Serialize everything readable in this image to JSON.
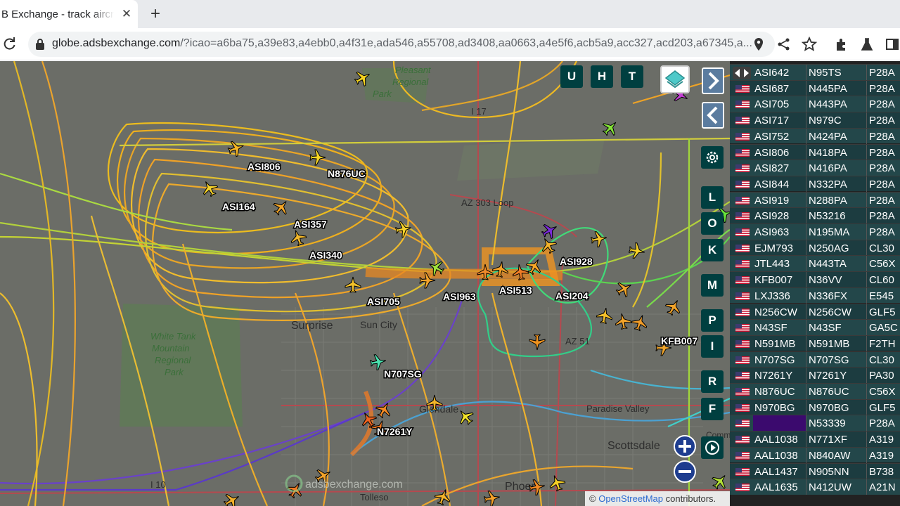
{
  "browser": {
    "tab_title": "B Exchange - track aircraft",
    "url_host": "globe.adsbexchange.com",
    "url_path": "/?icao=a6ba75,a39e83,a4ebb0,a4f31e,ada546,a55708,ad3408,aa0663,a4e5f6,acb5a9,acc327,acd203,a67345,a..."
  },
  "map_controls": {
    "u_label": "U",
    "h_label": "H",
    "t_label": "T",
    "side_buttons": [
      "L",
      "O",
      "K",
      "M",
      "P",
      "I",
      "R",
      "F"
    ]
  },
  "map": {
    "places": [
      {
        "text": "Surprise"
      },
      {
        "text": "Sun City"
      },
      {
        "text": "Scottsdale"
      },
      {
        "text": "Paradise Valley"
      },
      {
        "text": "AZ 303 Loop"
      },
      {
        "text": "AZ 51"
      },
      {
        "text": "I 17"
      },
      {
        "text": "I 10"
      },
      {
        "text": "Phoeni"
      },
      {
        "text": "Tolleso"
      },
      {
        "text": "Glendale"
      },
      {
        "text": "Comm"
      }
    ],
    "parks": [
      "White Tank",
      "Mountain",
      "Regional",
      "Park"
    ],
    "parks_top": [
      "Pleasant",
      "Regional",
      "Park"
    ],
    "aircraft_labels": [
      "ASI806",
      "N876UC",
      "ASI164",
      "ASI357",
      "ASI340",
      "ASI928",
      "ASI705",
      "ASI963",
      "ASI513",
      "ASI204",
      "N707SG",
      "N7261Y",
      "KFB007"
    ],
    "watermark": "adsbexchange.com",
    "attribution_prefix": "©",
    "attribution_link": "OpenStreetMap",
    "attribution_suffix": "contributors."
  },
  "table": {
    "rows": [
      {
        "callsign": "ASI642",
        "reg": "N95TS",
        "type": "P28A"
      },
      {
        "callsign": "ASI687",
        "reg": "N445PA",
        "type": "P28A"
      },
      {
        "callsign": "ASI705",
        "reg": "N443PA",
        "type": "P28A"
      },
      {
        "callsign": "ASI717",
        "reg": "N979C",
        "type": "P28A"
      },
      {
        "callsign": "ASI752",
        "reg": "N424PA",
        "type": "P28A"
      },
      {
        "callsign": "ASI806",
        "reg": "N418PA",
        "type": "P28A"
      },
      {
        "callsign": "ASI827",
        "reg": "N416PA",
        "type": "P28A"
      },
      {
        "callsign": "ASI844",
        "reg": "N332PA",
        "type": "P28A"
      },
      {
        "callsign": "ASI919",
        "reg": "N288PA",
        "type": "P28A"
      },
      {
        "callsign": "ASI928",
        "reg": "N53216",
        "type": "P28A"
      },
      {
        "callsign": "ASI963",
        "reg": "N195MA",
        "type": "P28A"
      },
      {
        "callsign": "EJM793",
        "reg": "N250AG",
        "type": "CL30"
      },
      {
        "callsign": "JTL443",
        "reg": "N443TA",
        "type": "C56X"
      },
      {
        "callsign": "KFB007",
        "reg": "N36VV",
        "type": "CL60"
      },
      {
        "callsign": "LXJ336",
        "reg": "N336FX",
        "type": "E545"
      },
      {
        "callsign": "N256CW",
        "reg": "N256CW",
        "type": "GLF5"
      },
      {
        "callsign": "N43SF",
        "reg": "N43SF",
        "type": "GA5C"
      },
      {
        "callsign": "N591MB",
        "reg": "N591MB",
        "type": "F2TH"
      },
      {
        "callsign": "N707SG",
        "reg": "N707SG",
        "type": "CL30"
      },
      {
        "callsign": "N7261Y",
        "reg": "N7261Y",
        "type": "PA30"
      },
      {
        "callsign": "N876UC",
        "reg": "N876UC",
        "type": "C56X"
      },
      {
        "callsign": "N970BG",
        "reg": "N970BG",
        "type": "GLF5"
      },
      {
        "callsign": "",
        "reg": "N53339",
        "type": "P28A",
        "highlight": true
      },
      {
        "callsign": "AAL1038",
        "reg": "N771XF",
        "type": "A319"
      },
      {
        "callsign": "AAL1038",
        "reg": "N840AW",
        "type": "A319"
      },
      {
        "callsign": "AAL1437",
        "reg": "N905NN",
        "type": "B738"
      },
      {
        "callsign": "AAL1635",
        "reg": "N412UW",
        "type": "A21N"
      }
    ]
  }
}
